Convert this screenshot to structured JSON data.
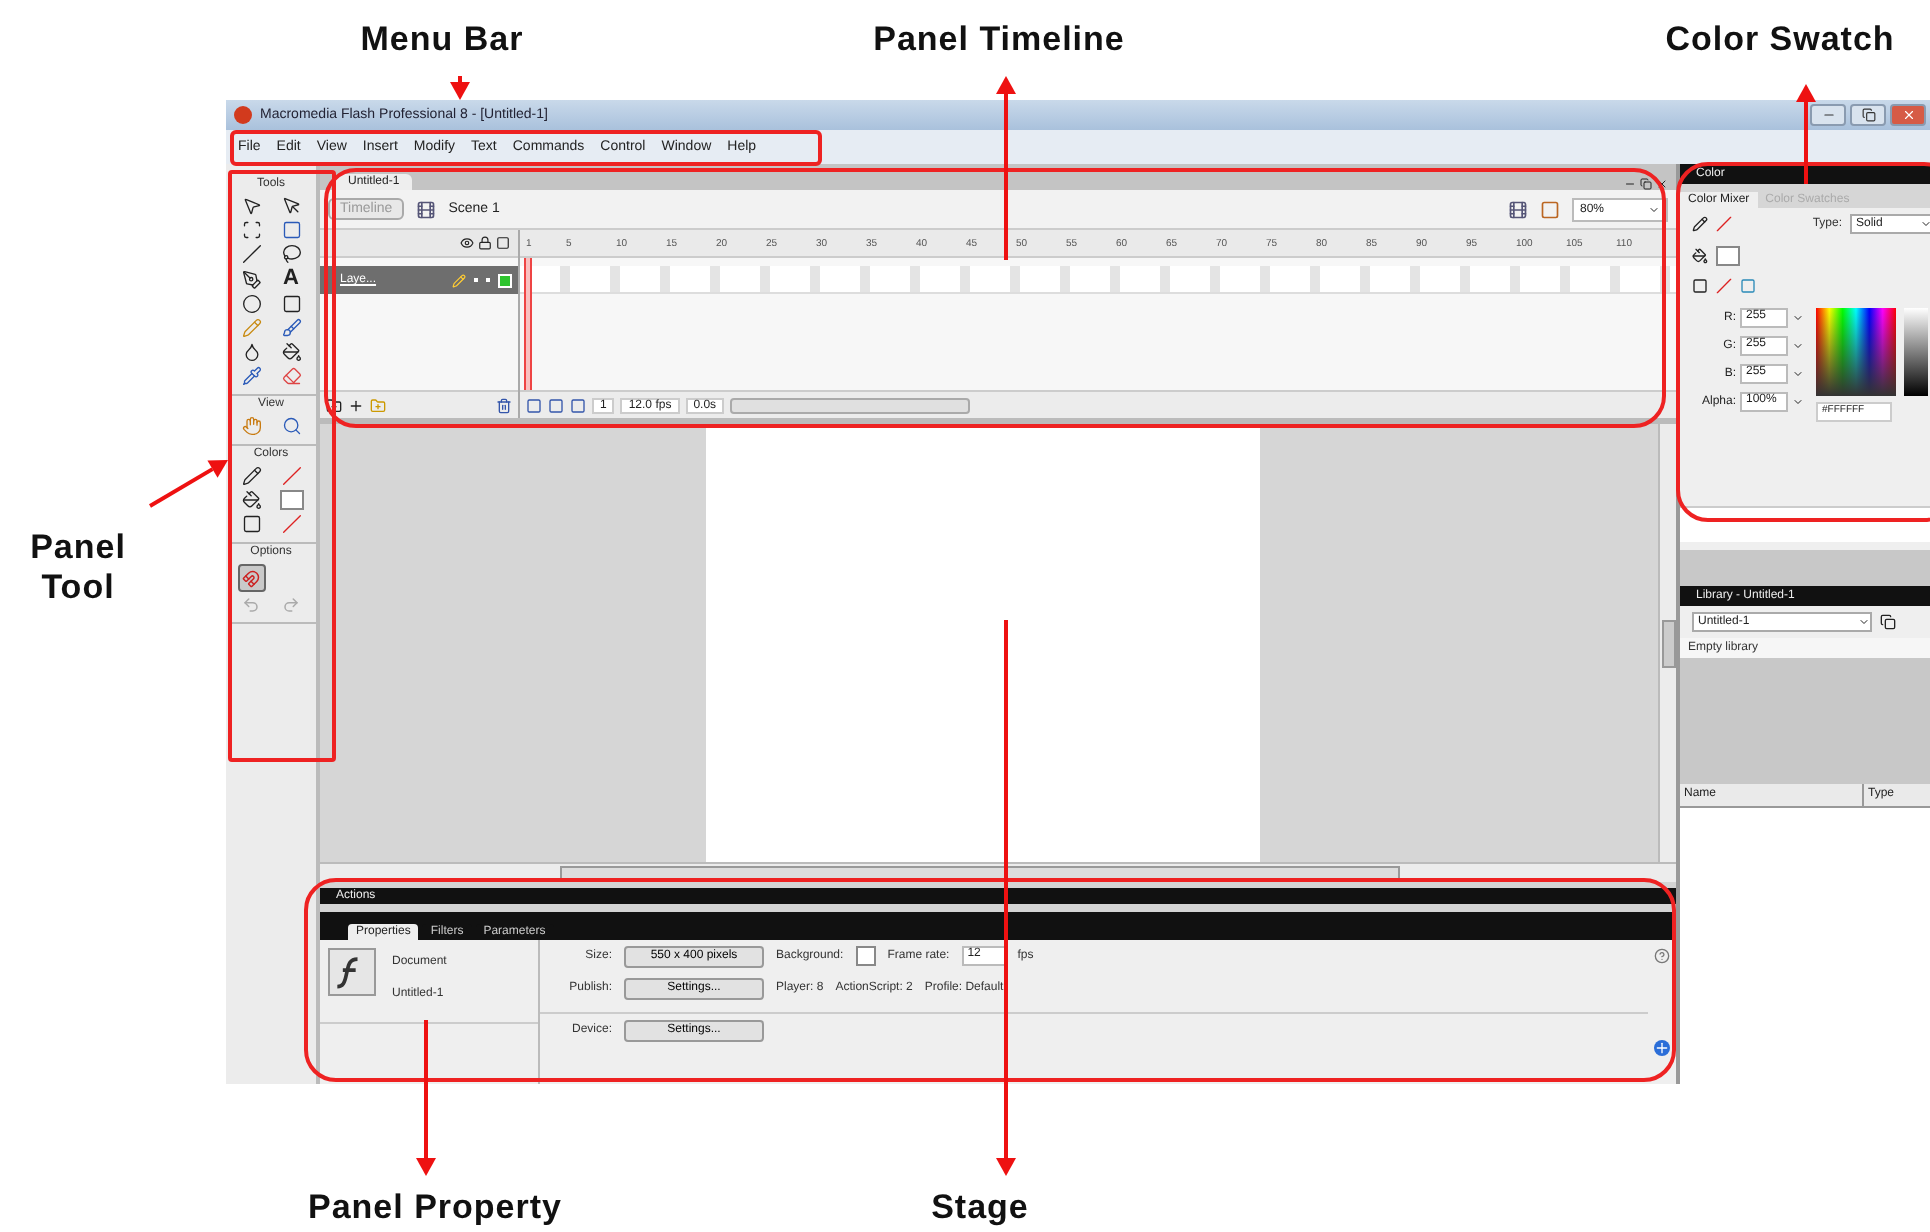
{
  "annotations": [
    {
      "label": "Menu Bar"
    },
    {
      "label": "Panel Timeline"
    },
    {
      "label": "Color Swatch"
    },
    {
      "label": "Panel Tool"
    },
    {
      "label": "Panel Property"
    },
    {
      "label": "Stage"
    }
  ],
  "window": {
    "title": "Macromedia Flash Professional 8 - [Untitled-1]"
  },
  "menu_bar": [
    "File",
    "Edit",
    "View",
    "Insert",
    "Modify",
    "Text",
    "Commands",
    "Control",
    "Window",
    "Help"
  ],
  "tools": {
    "title": "Tools",
    "text_tool": "A",
    "sections": [
      "View",
      "Colors",
      "Options"
    ]
  },
  "document_tab": "Untitled-1",
  "timeline": {
    "button": "Timeline",
    "scene": "Scene 1",
    "zoom": "80%",
    "frames": [
      "1",
      "5",
      "10",
      "15",
      "20",
      "25",
      "30",
      "35",
      "40",
      "45",
      "50",
      "55",
      "60",
      "65",
      "70",
      "75",
      "80",
      "85",
      "90",
      "95",
      "100",
      "105",
      "110"
    ],
    "layers": [
      {
        "name": "Laye...",
        "selected": true
      }
    ],
    "current_frame": "1",
    "frame_rate": "12.0 fps",
    "elapsed": "0.0s"
  },
  "color_panel": {
    "title": "Color",
    "tabs": [
      {
        "label": "Color Mixer",
        "selected": true
      },
      {
        "label": "Color Swatches",
        "selected": false
      }
    ],
    "type_label": "Type:",
    "type_value": "Solid",
    "channels": [
      {
        "label": "R:",
        "value": "255"
      },
      {
        "label": "G:",
        "value": "255"
      },
      {
        "label": "B:",
        "value": "255"
      },
      {
        "label": "Alpha:",
        "value": "100%"
      }
    ],
    "hex": "#FFFFFF"
  },
  "library": {
    "title": "Library - Untitled-1",
    "document": "Untitled-1",
    "status": "Empty library",
    "columns": [
      "Name",
      "Type"
    ]
  },
  "actions_bar": "Actions",
  "properties": {
    "tabs": [
      {
        "label": "Properties",
        "selected": true
      },
      {
        "label": "Filters",
        "selected": false
      },
      {
        "label": "Parameters",
        "selected": false
      }
    ],
    "doc_kind": "Document",
    "doc_name": "Untitled-1",
    "size_label": "Size:",
    "size_value": "550 x 400 pixels",
    "background_label": "Background:",
    "frame_rate_label": "Frame rate:",
    "frame_rate": "12",
    "fps": "fps",
    "publish_label": "Publish:",
    "publish_button": "Settings...",
    "player": "Player: 8",
    "actionscript": "ActionScript: 2",
    "profile": "Profile: Default",
    "device_label": "Device:",
    "device_button": "Settings..."
  }
}
